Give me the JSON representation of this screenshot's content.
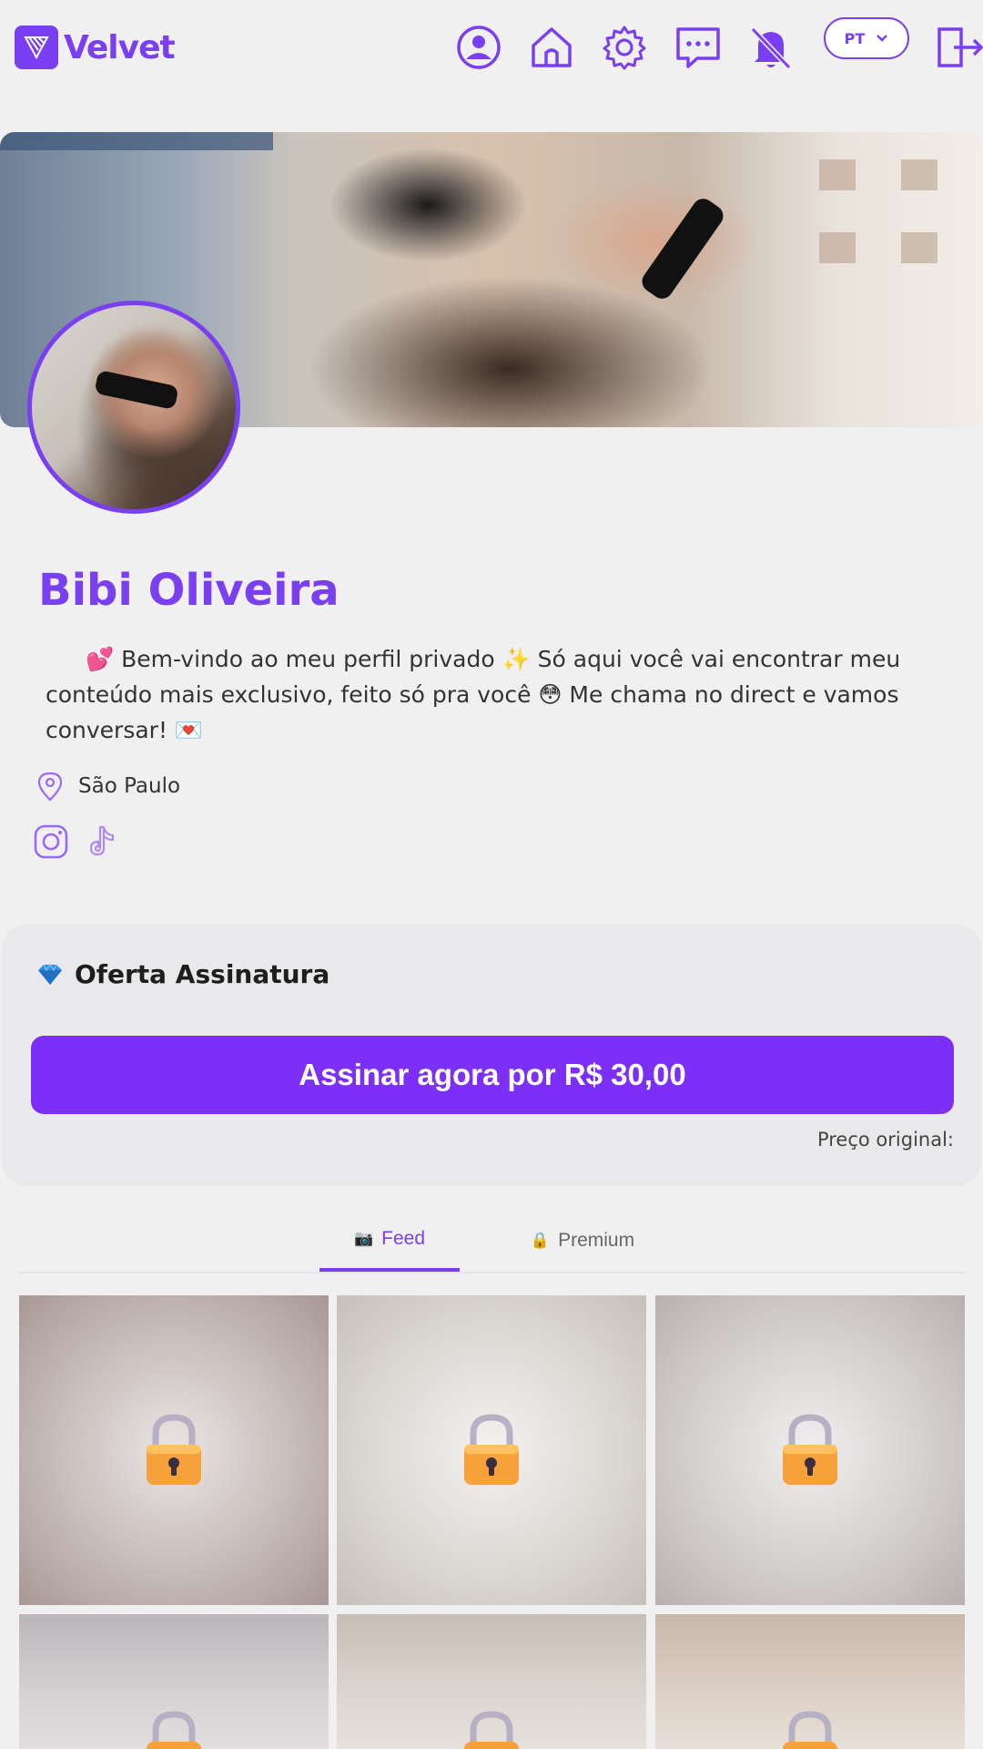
{
  "header": {
    "brand": "Velvet",
    "language": "PT",
    "icons": [
      "user-icon",
      "home-icon",
      "gear-icon",
      "chat-icon",
      "bell-off-icon",
      "logout-icon"
    ]
  },
  "profile": {
    "name": "Bibi Oliveira",
    "bio": "💕 Bem-vindo ao meu perfil privado ✨ Só aqui você vai encontrar meu conteúdo mais exclusivo, feito só pra você 😳 Me chama no direct e vamos conversar! 💌",
    "location": "São Paulo",
    "socials": [
      "instagram-icon",
      "tiktok-icon"
    ]
  },
  "offer": {
    "icon": "💎",
    "title": "Oferta Assinatura",
    "button_label": "Assinar agora por R$ 30,00",
    "original_price_label": "Preço original:"
  },
  "tabs": [
    {
      "label": "Feed",
      "glyph": "📷",
      "active": true
    },
    {
      "label": "Premium",
      "glyph": "🔒",
      "active": false
    }
  ],
  "colors": {
    "accent": "#7b3ff2",
    "button": "#7b2ff7",
    "background": "#f1f0f1"
  }
}
